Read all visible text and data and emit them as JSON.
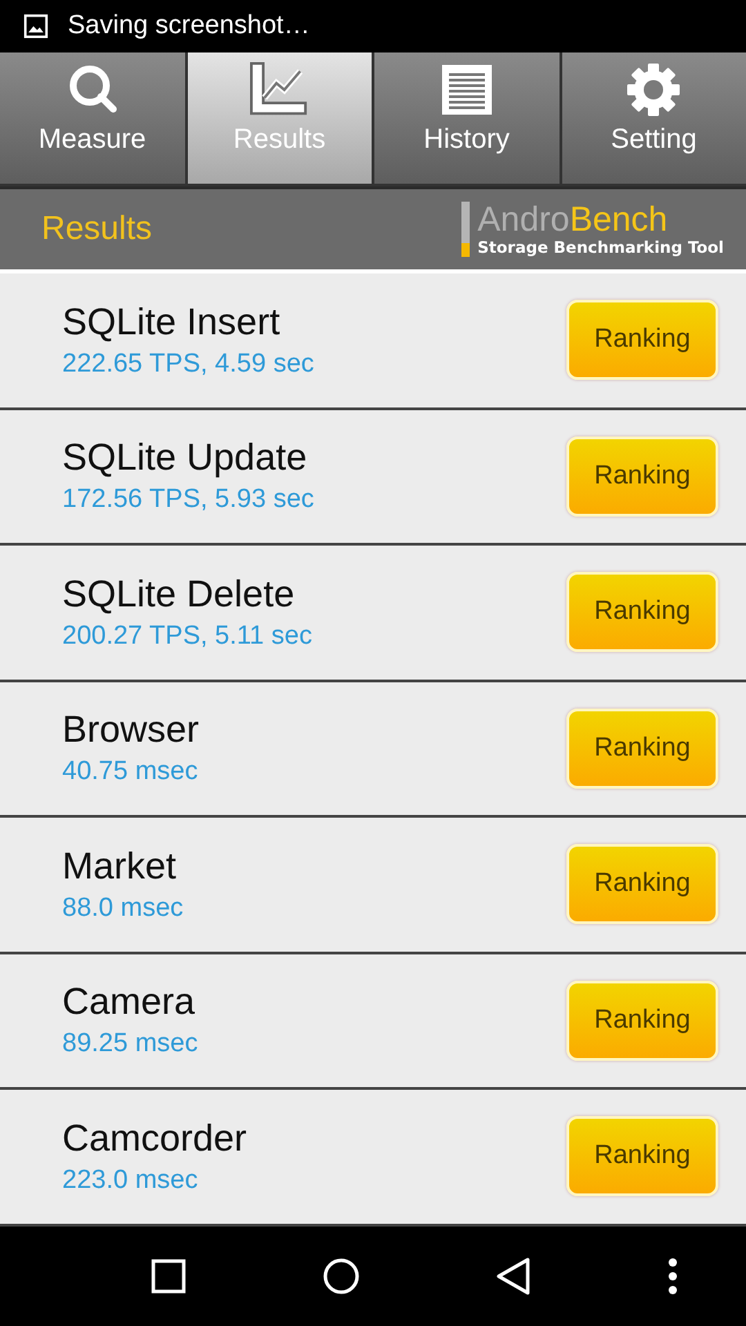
{
  "status_bar": {
    "notification": "Saving screenshot…"
  },
  "tabs": [
    {
      "label": "Measure",
      "kind": "search",
      "selected": false
    },
    {
      "label": "Results",
      "kind": "chart",
      "selected": true
    },
    {
      "label": "History",
      "kind": "list",
      "selected": false
    },
    {
      "label": "Setting",
      "kind": "gear",
      "selected": false
    }
  ],
  "header": {
    "title": "Results",
    "logo": {
      "title_start": "Andro",
      "title_end": "Bench",
      "tagline": "Storage Benchmarking Tool"
    }
  },
  "results": [
    {
      "name": "SQLite Insert",
      "value": "222.65 TPS, 4.59 sec",
      "button": "Ranking"
    },
    {
      "name": "SQLite Update",
      "value": "172.56 TPS, 5.93 sec",
      "button": "Ranking"
    },
    {
      "name": "SQLite Delete",
      "value": "200.27 TPS, 5.11 sec",
      "button": "Ranking"
    },
    {
      "name": "Browser",
      "value": "40.75 msec",
      "button": "Ranking"
    },
    {
      "name": "Market",
      "value": "88.0 msec",
      "button": "Ranking"
    },
    {
      "name": "Camera",
      "value": "89.25 msec",
      "button": "Ranking"
    },
    {
      "name": "Camcorder",
      "value": "223.0 msec",
      "button": "Ranking"
    }
  ]
}
